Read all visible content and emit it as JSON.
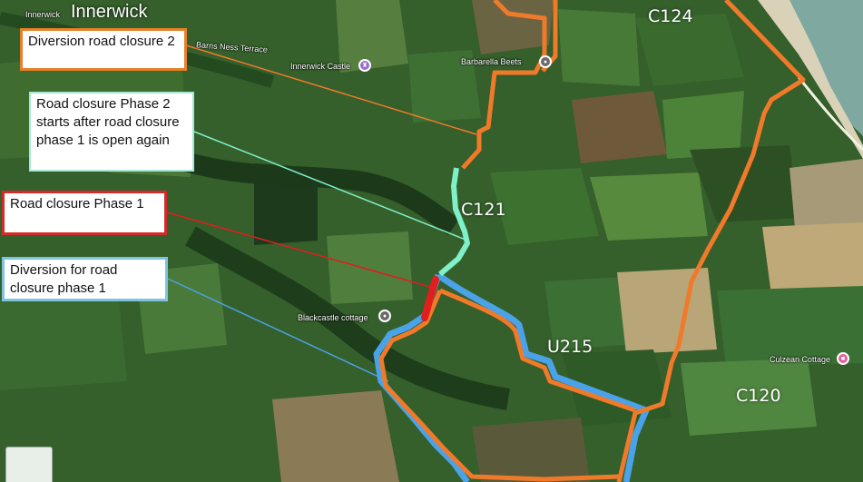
{
  "places": {
    "innerwick_small": "Innerwick",
    "innerwick_big": "Innerwick",
    "barns_ness_terrace": "Barns Ness Terrace",
    "innerwick_castle": "Innerwick Castle",
    "barbarella_beets": "Barbarella Beets",
    "blackcastle_cottage": "Blackcastle cottage",
    "culzean_cottage": "Culzean Cottage"
  },
  "road_codes": {
    "c124": "C124",
    "c121": "C121",
    "u215": "U215",
    "c120": "C120"
  },
  "annotations": {
    "diversion_phase2": "Diversion road closure 2",
    "closure_phase2": "Road closure Phase 2 starts after road closure phase 1 is open again",
    "closure_phase1": "Road closure Phase 1",
    "diversion_phase1": "Diversion for road closure phase 1"
  },
  "icons": {
    "innerwick_castle_pin": "castle-pin-icon",
    "barbarella_beets_pin": "shop-pin-icon",
    "blackcastle_pin": "place-pin-icon",
    "culzean_pin": "lodging-pin-icon"
  },
  "colors": {
    "diversion_phase2": "#f07a2a",
    "closure_phase2": "#7ff0c8",
    "closure_phase1": "#e01e1e",
    "diversion_phase1": "#4aa3e8",
    "box_border_orange": "#e8802a",
    "box_border_mint": "#a8e6d6",
    "box_border_red": "#d42a2a",
    "box_border_blue": "#7ec3df"
  }
}
